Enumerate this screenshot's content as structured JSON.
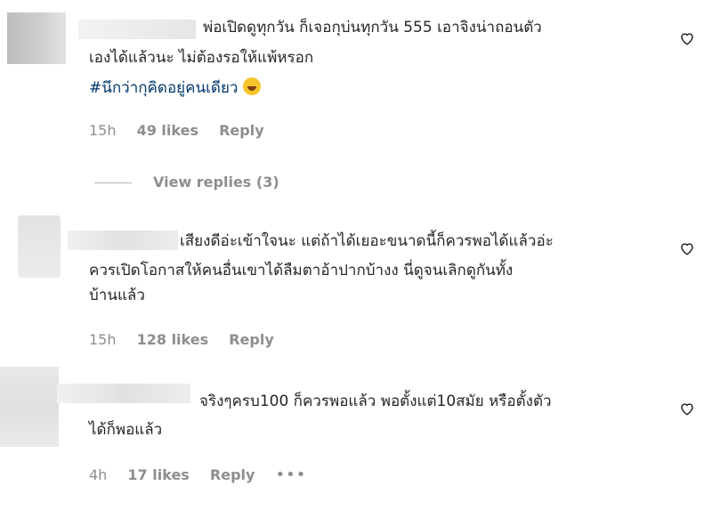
{
  "comments": [
    {
      "line1": "พ่อเปิดดูทุกวัน ก็เจอกุบ่นทุกวัน 555 เอาจิงน่าถอนตัว",
      "line2": "เองได้แล้วนะ ไม่ต้องรอให้แพ้หรอก",
      "hashtag": "#นึกว่ากุคิดอยู่คนเดียว",
      "emoji": "face-with-tears-of-joy",
      "time": "15h",
      "likes": "49 likes",
      "reply": "Reply",
      "view_replies": "View replies (3)"
    },
    {
      "line1": "เสียงดีอ่ะเข้าใจนะ แต่ถ้าได้เยอะขนาดนี้ก็ควรพอได้แล้วอ่ะ",
      "line2": "ควรเปิดโอกาสให้คนอื่นเขาได้ลืมตาอ้าปากบ้างง นี่ดูจนเลิกดูกันทั้ง",
      "line3": "บ้านแล้ว",
      "time": "15h",
      "likes": "128 likes",
      "reply": "Reply"
    },
    {
      "line1": "จริงๆครบ100 ก็ควรพอแล้ว พอตั้งแต่10สมัย หรือตั้งตัว",
      "line2": "ได้ก็พอแล้ว",
      "time": "4h",
      "likes": "17 likes",
      "reply": "Reply",
      "more": "•••"
    }
  ]
}
